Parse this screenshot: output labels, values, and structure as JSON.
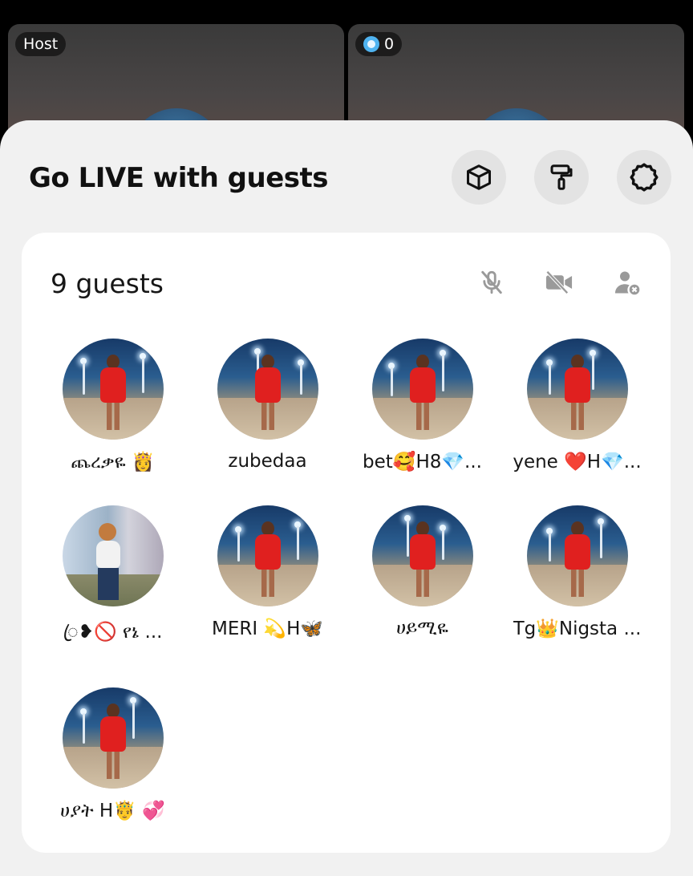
{
  "host_tile": {
    "badge": "Host"
  },
  "guest_tile": {
    "coins": "0"
  },
  "sheet": {
    "title": "Go LIVE with guests",
    "buttons": [
      {
        "icon": "cube-icon"
      },
      {
        "icon": "paint-roller-icon"
      },
      {
        "icon": "gear-icon"
      }
    ]
  },
  "guests_card": {
    "count_label": "9 guests",
    "tools": [
      "mic-off-icon",
      "camera-off-icon",
      "remove-user-icon"
    ],
    "guests": [
      {
        "name": "ጨረቃዬ 👸"
      },
      {
        "name": "zubedaa"
      },
      {
        "name": "bet🥰H8💎..."
      },
      {
        "name": "yene ❤️H💎..."
      },
      {
        "name": "ꦿ❥🚫 የኔ ..."
      },
      {
        "name": "MERI 💫H🦋"
      },
      {
        "name": "ሀይሚዬ"
      },
      {
        "name": "Tg👑Nigsta ..."
      },
      {
        "name": "ሀያት H🤴 💞"
      }
    ]
  },
  "colors": {
    "sheet_bg": "#f1f1f1",
    "card_bg": "#ffffff",
    "button_bg": "#e3e3e3",
    "coin": "#4fb3f0"
  }
}
